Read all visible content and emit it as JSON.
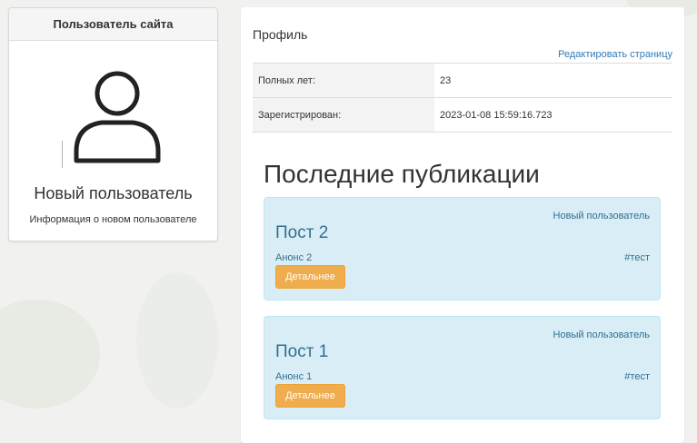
{
  "sidebar": {
    "heading": "Пользователь сайта",
    "user_name": "Новый пользователь",
    "user_info": "Информация о новом пользователе"
  },
  "profile": {
    "title": "Профиль",
    "edit_link": "Редактировать страницу",
    "rows": [
      {
        "label": "Полных лет:",
        "value": "23"
      },
      {
        "label": "Зарегистрирован:",
        "value": "2023-01-08 15:59:16.723"
      }
    ]
  },
  "publications": {
    "title": "Последние публикации",
    "posts": [
      {
        "author": "Новый пользователь",
        "title": "Пост 2",
        "anons": "Анонс 2",
        "tag": "#тест",
        "button": "Детальнее"
      },
      {
        "author": "Новый пользователь",
        "title": "Пост 1",
        "anons": "Анонс 1",
        "tag": "#тест",
        "button": "Детальнее"
      }
    ]
  },
  "colors": {
    "link": "#337ab7",
    "post_bg": "#d9edf7",
    "post_text": "#31708f",
    "button": "#f0ad4e"
  },
  "icons": {
    "avatar": "user-silhouette-icon"
  }
}
